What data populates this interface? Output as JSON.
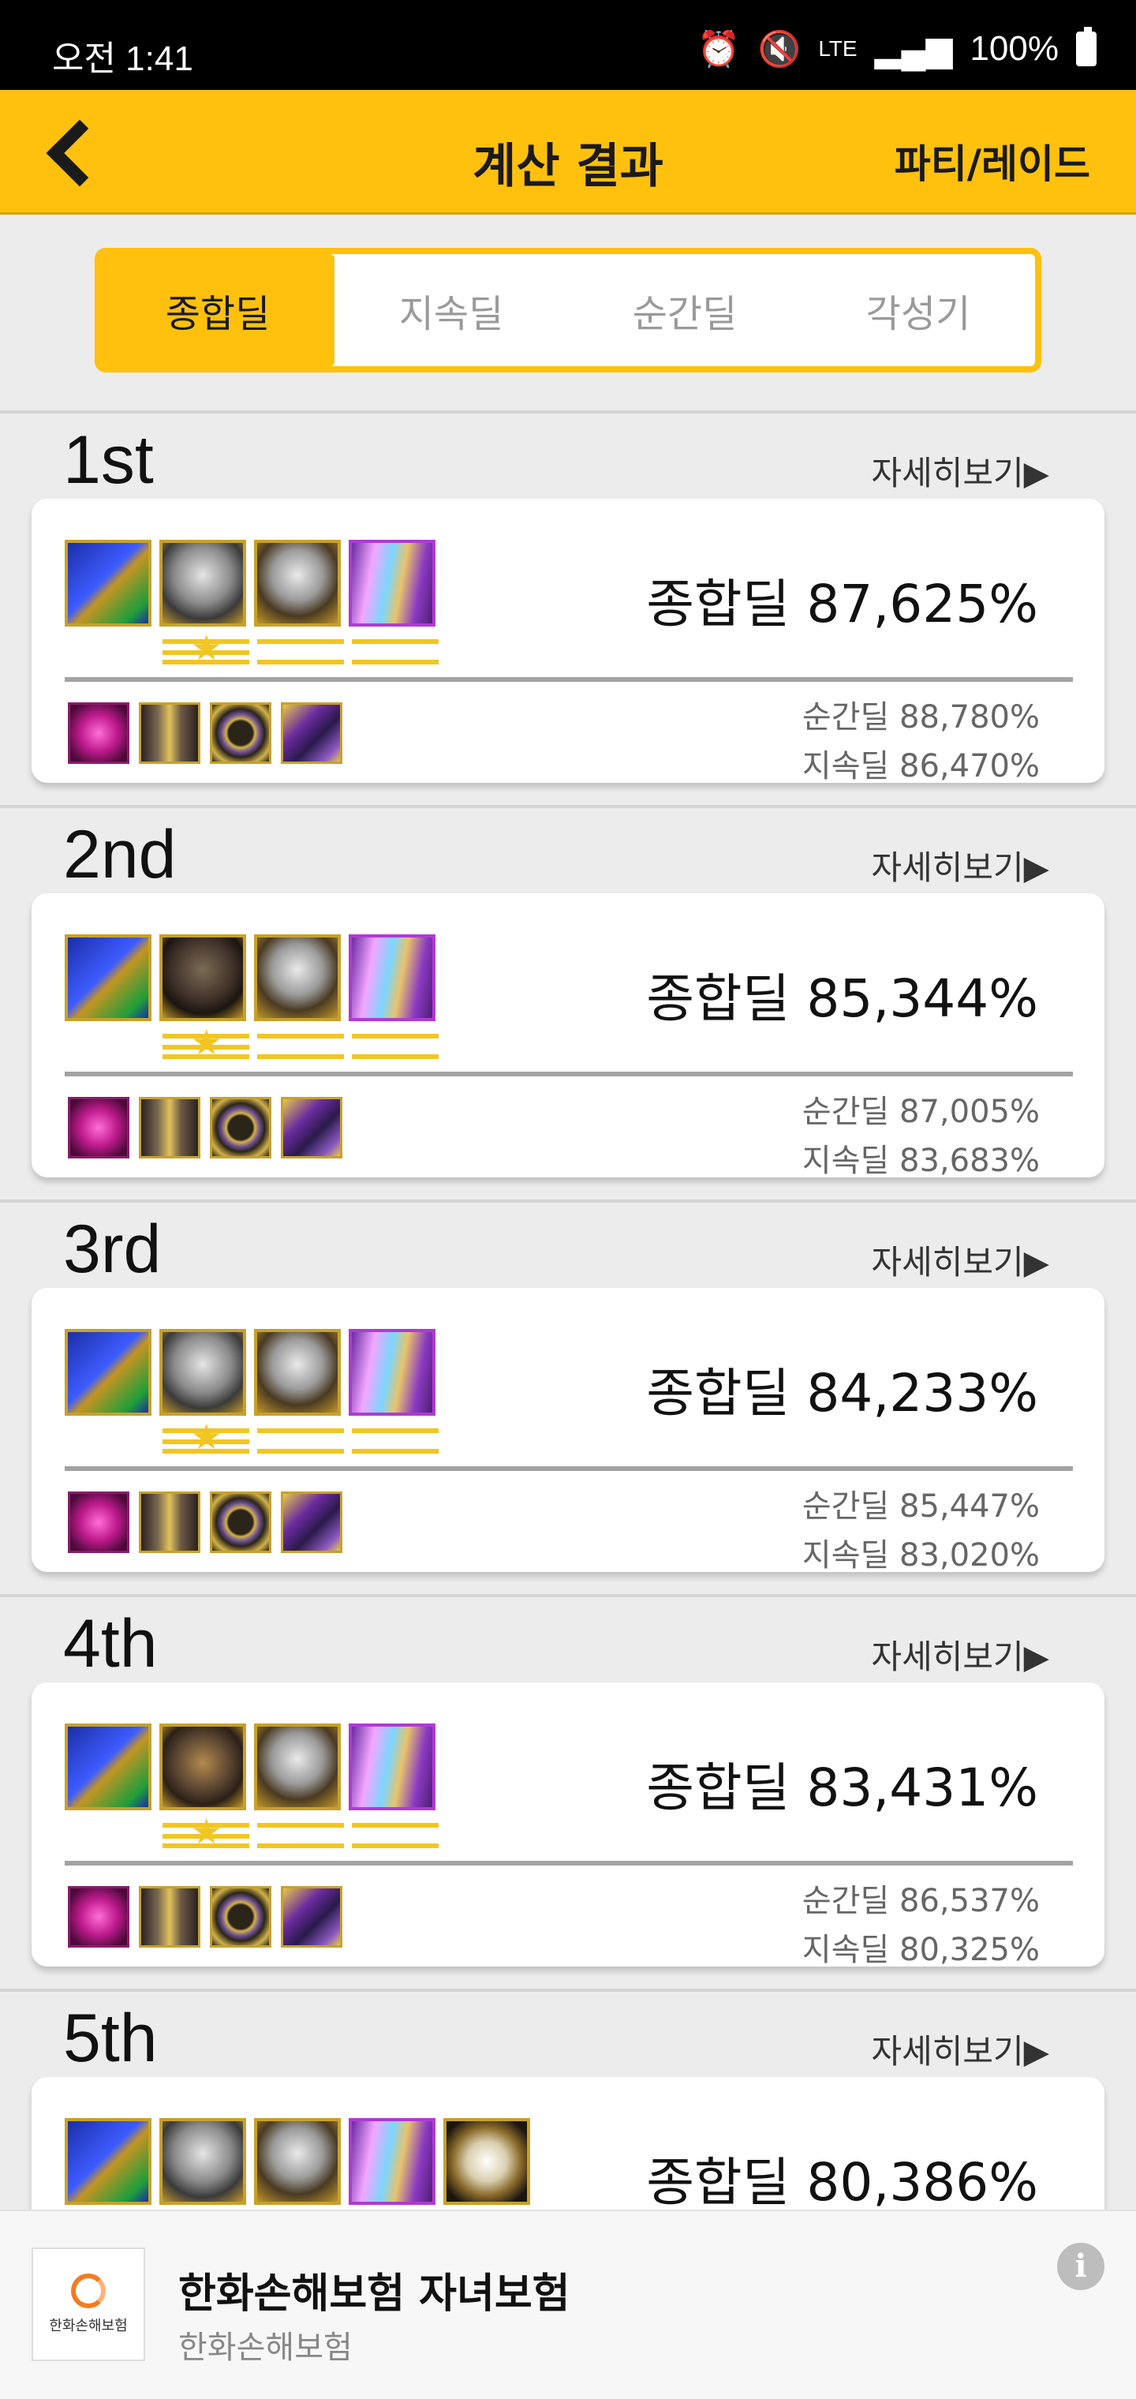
{
  "status": {
    "time": "오전 1:41",
    "network": "LTE",
    "battery": "100%"
  },
  "header": {
    "title": "계산 결과",
    "right_action": "파티/레이드"
  },
  "tabs": [
    {
      "label": "종합딜",
      "active": true
    },
    {
      "label": "지속딜",
      "active": false
    },
    {
      "label": "순간딜",
      "active": false
    },
    {
      "label": "각성기",
      "active": false
    }
  ],
  "results": [
    {
      "rank": "1st",
      "detail_label": "자세히보기▶",
      "total": "종합딜 87,625%",
      "burst": "순간딜 88,780%",
      "sustained": "지속딜 86,470%",
      "equipment": [
        "weapon-icon",
        "armor-icon",
        "helmet-icon",
        "cape-icon"
      ],
      "accessories": [
        "gem-icon",
        "pants-icon",
        "ring-icon",
        "shoulder-icon"
      ]
    },
    {
      "rank": "2nd",
      "detail_label": "자세히보기▶",
      "total": "종합딜 85,344%",
      "burst": "순간딜 87,005%",
      "sustained": "지속딜 83,683%",
      "equipment": [
        "weapon-icon",
        "armor-icon",
        "helmet-icon",
        "cape-icon"
      ],
      "accessories": [
        "gem-icon",
        "pants-icon",
        "ring-icon",
        "shoulder-icon"
      ]
    },
    {
      "rank": "3rd",
      "detail_label": "자세히보기▶",
      "total": "종합딜 84,233%",
      "burst": "순간딜 85,447%",
      "sustained": "지속딜 83,020%",
      "equipment": [
        "weapon-icon",
        "armor-icon",
        "helmet-icon",
        "cape-icon"
      ],
      "accessories": [
        "gem-icon",
        "pants-icon",
        "ring-icon",
        "shoulder-icon"
      ]
    },
    {
      "rank": "4th",
      "detail_label": "자세히보기▶",
      "total": "종합딜 83,431%",
      "burst": "순간딜 86,537%",
      "sustained": "지속딜 80,325%",
      "equipment": [
        "weapon-icon",
        "armor-icon",
        "helmet-icon",
        "cape-icon"
      ],
      "accessories": [
        "gem-icon",
        "pants-icon",
        "ring-icon",
        "shoulder-icon"
      ]
    },
    {
      "rank": "5th",
      "detail_label": "자세히보기▶",
      "total": "종합딜 80,386%",
      "equipment": [
        "weapon-icon",
        "armor-icon",
        "helmet-icon",
        "cape-icon",
        "boots-icon"
      ]
    }
  ],
  "ad": {
    "logo_text": "한화손해보험",
    "title": "한화손해보험 자녀보험",
    "subtitle": "한화손해보험",
    "info_icon": "i"
  },
  "colors": {
    "accent": "#ffc10d",
    "background": "#ececec",
    "card": "#ffffff"
  }
}
